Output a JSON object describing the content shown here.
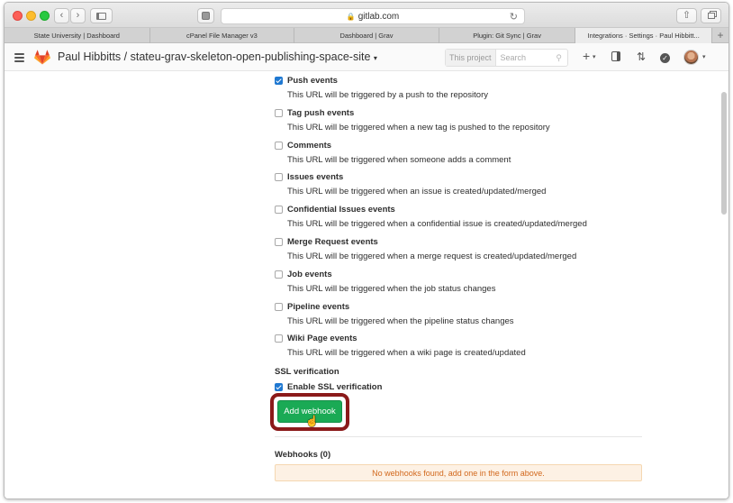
{
  "browser": {
    "address": "gitlab.com",
    "tabs": [
      {
        "label": "State University | Dashboard",
        "active": false
      },
      {
        "label": "cPanel File Manager v3",
        "active": false
      },
      {
        "label": "Dashboard | Grav",
        "active": false
      },
      {
        "label": "Plugin: Git Sync | Grav",
        "active": false
      },
      {
        "label": "Integrations · Settings · Paul Hibbitt...",
        "active": true
      }
    ]
  },
  "header": {
    "breadcrumb": "Paul Hibbitts / stateu-grav-skeleton-open-publishing-space-site",
    "search_scope": "This project",
    "search_placeholder": "Search"
  },
  "events": [
    {
      "name": "push",
      "label": "Push events",
      "description": "This URL will be triggered by a push to the repository",
      "checked": true
    },
    {
      "name": "tag-push",
      "label": "Tag push events",
      "description": "This URL will be triggered when a new tag is pushed to the repository",
      "checked": false
    },
    {
      "name": "comments",
      "label": "Comments",
      "description": "This URL will be triggered when someone adds a comment",
      "checked": false
    },
    {
      "name": "issues",
      "label": "Issues events",
      "description": "This URL will be triggered when an issue is created/updated/merged",
      "checked": false
    },
    {
      "name": "confidential-issues",
      "label": "Confidential Issues events",
      "description": "This URL will be triggered when a confidential issue is created/updated/merged",
      "checked": false
    },
    {
      "name": "merge-request",
      "label": "Merge Request events",
      "description": "This URL will be triggered when a merge request is created/updated/merged",
      "checked": false
    },
    {
      "name": "job",
      "label": "Job events",
      "description": "This URL will be triggered when the job status changes",
      "checked": false
    },
    {
      "name": "pipeline",
      "label": "Pipeline events",
      "description": "This URL will be triggered when the pipeline status changes",
      "checked": false
    },
    {
      "name": "wiki-page",
      "label": "Wiki Page events",
      "description": "This URL will be triggered when a wiki page is created/updated",
      "checked": false
    }
  ],
  "ssl": {
    "section_label": "SSL verification",
    "checkbox_label": "Enable SSL verification",
    "checked": true
  },
  "add_button": "Add webhook",
  "webhooks": {
    "title": "Webhooks (0)",
    "empty_message": "No webhooks found, add one in the form above."
  }
}
